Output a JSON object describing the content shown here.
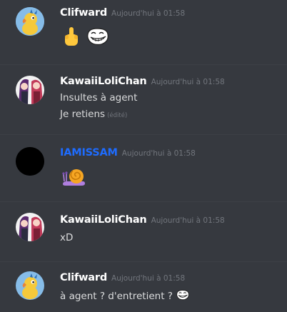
{
  "messages": [
    {
      "username": "Clifward",
      "timestamp": "Aujourd'hui à 01:58",
      "avatar": "parrot-cartoon-avatar",
      "emojis": [
        "middle-finger-emoji",
        "trollface-emoji"
      ]
    },
    {
      "username": "KawaiiLoliChan",
      "timestamp": "Aujourd'hui à 01:58",
      "avatar": "anime-girls-avatar",
      "lines": [
        "Insultes à agent",
        "Je retiens"
      ],
      "edited_label": "(édité)"
    },
    {
      "username": "IAMISSAM",
      "timestamp": "Aujourd'hui à 01:58",
      "avatar": "black-circle-avatar",
      "username_color": "#1e6cff",
      "emojis": [
        "snail-emoji"
      ]
    },
    {
      "username": "KawaiiLoliChan",
      "timestamp": "Aujourd'hui à 01:58",
      "avatar": "anime-girls-avatar",
      "lines": [
        "xD"
      ]
    },
    {
      "username": "Clifward",
      "timestamp": "Aujourd'hui à 01:58",
      "avatar": "parrot-cartoon-avatar",
      "lines": [
        "à agent ? d'entretient ?"
      ],
      "inline_emoji": "trollface-emoji"
    }
  ],
  "colors": {
    "background": "#36393f",
    "username": "#ffffff",
    "username_blue": "#1e6cff",
    "timestamp": "#72767d",
    "text": "#dcddde"
  }
}
